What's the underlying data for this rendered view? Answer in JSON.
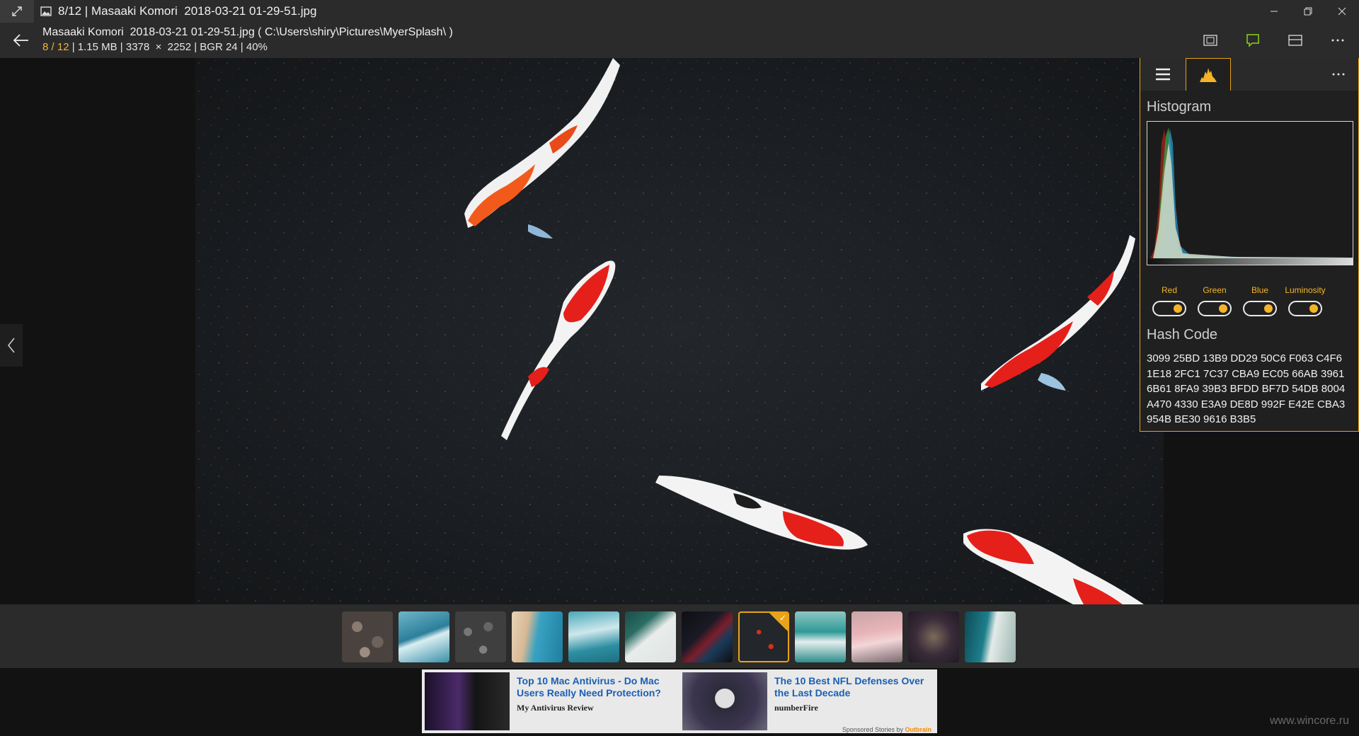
{
  "window": {
    "title": "8/12 | Masaaki Komori  2018-03-21 01-29-51.jpg"
  },
  "info": {
    "file_line": "Masaaki Komori  2018-03-21 01-29-51.jpg ( C:\\Users\\shiry\\Pictures\\MyerSplash\\ )",
    "index": "8",
    "sep": "/",
    "total": "12",
    "details": "| 1.15 MB | 3378  ×  2252 | BGR 24 | 40%"
  },
  "top_actions": [
    "slideshow-icon",
    "comment-icon",
    "layout-icon",
    "more-icon"
  ],
  "panel": {
    "histogram_title": "Histogram",
    "channels": [
      {
        "label": "Red",
        "on": true
      },
      {
        "label": "Green",
        "on": true
      },
      {
        "label": "Blue",
        "on": true
      },
      {
        "label": "Luminosity",
        "on": true
      }
    ],
    "hash_title": "Hash Code",
    "hash_lines": [
      "3099 25BD 13B9 DD29 50C6 F063 C4F6",
      "1E18 2FC1 7C37 CBA9 EC05 66AB 3961",
      "6B61 8FA9 39B3 BFDD BF7D 54DB 8004",
      "A470 4330 E3A9 DE8D 992F E42E CBA3",
      "954B BE30 9616 B3B5"
    ]
  },
  "thumbnails": [
    {
      "name": "pebbles"
    },
    {
      "name": "wave"
    },
    {
      "name": "stones"
    },
    {
      "name": "beach-aerial"
    },
    {
      "name": "surf"
    },
    {
      "name": "ice"
    },
    {
      "name": "dark-river"
    },
    {
      "name": "koi",
      "selected": true
    },
    {
      "name": "shoreline"
    },
    {
      "name": "pink-sea"
    },
    {
      "name": "forest"
    },
    {
      "name": "coast-aerial"
    }
  ],
  "ads": [
    {
      "headline": "Top 10 Mac Antivirus - Do Mac Users Really Need Protection?",
      "source": "My Antivirus Review"
    },
    {
      "headline": "The 10 Best NFL Defenses Over the Last Decade",
      "source": "numberFire"
    }
  ],
  "ad_sponsored": "Sponsored Stories by",
  "ad_sponsor_brand": "Outbrain",
  "watermark": "www.wincore.ru",
  "accent": "#e8a317"
}
